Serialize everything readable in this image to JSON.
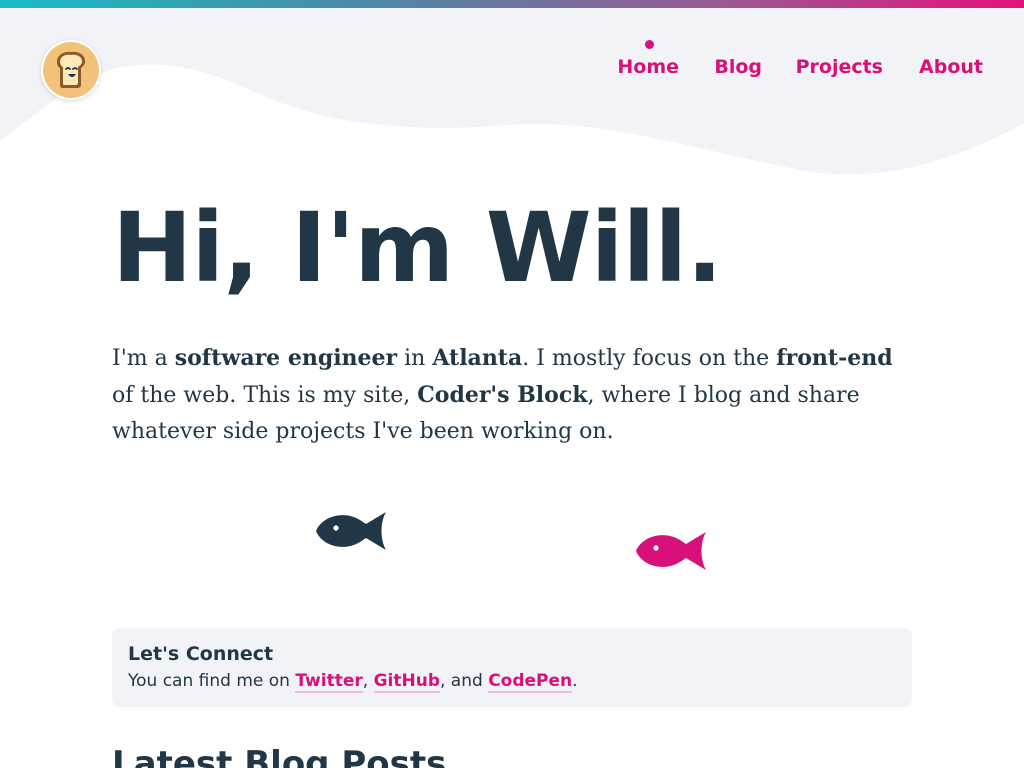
{
  "colors": {
    "accent": "#d8107a",
    "text": "#213746",
    "panel": "#f1f3f6",
    "gradient_start": "#1bbcc4",
    "gradient_end": "#e3127c"
  },
  "header": {
    "logo_icon": "toast-smiley-icon",
    "nav": [
      {
        "label": "Home",
        "active": true
      },
      {
        "label": "Blog",
        "active": false
      },
      {
        "label": "Projects",
        "active": false
      },
      {
        "label": "About",
        "active": false
      }
    ]
  },
  "hero": {
    "title": "Hi, I'm Will.",
    "intro": {
      "p1": "I'm a ",
      "role": "software engineer",
      "p2": " in ",
      "city": "Atlanta",
      "p3": ". I mostly focus on the ",
      "focus": "front-end",
      "p4": " of the web. This is my site, ",
      "site": "Coder's Block",
      "p5": ", where I blog and share whatever side projects I've been working on."
    }
  },
  "fish": [
    {
      "name": "fish-icon-dark",
      "color": "#213746"
    },
    {
      "name": "fish-icon-pink",
      "color": "#d8107a"
    }
  ],
  "connect": {
    "title": "Let's Connect",
    "prefix": "You can find me on ",
    "links": [
      "Twitter",
      "GitHub",
      "CodePen"
    ],
    "sep1": ", ",
    "sep2": ", and ",
    "suffix": "."
  },
  "latest": {
    "title": "Latest Blog Posts"
  }
}
